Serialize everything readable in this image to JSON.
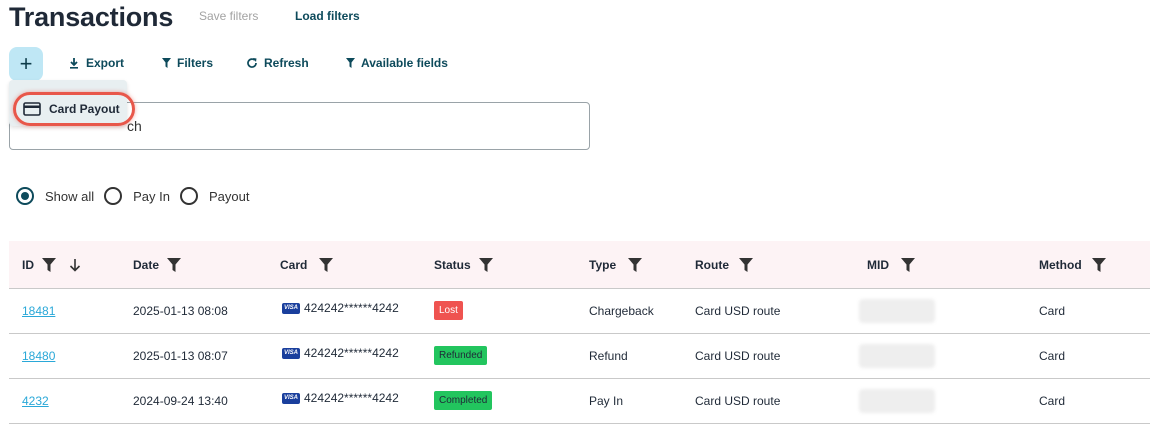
{
  "header": {
    "title": "Transactions",
    "save_filters": "Save filters",
    "load_filters": "Load filters"
  },
  "toolbar": {
    "add": "+",
    "export": "Export",
    "filters": "Filters",
    "refresh": "Refresh",
    "available_fields": "Available fields"
  },
  "dropdown": {
    "item": "Card Payout"
  },
  "search": {
    "visible_text": "ch"
  },
  "radios": {
    "show_all": "Show all",
    "pay_in": "Pay In",
    "payout": "Payout",
    "selected": "show_all"
  },
  "table": {
    "headers": {
      "id": "ID",
      "date": "Date",
      "card": "Card",
      "status": "Status",
      "type": "Type",
      "route": "Route",
      "mid": "MID",
      "method": "Method"
    },
    "rows": [
      {
        "id": "18481",
        "date": "2025-01-13 08:08",
        "card": "424242******4242",
        "status": "Lost",
        "type": "Chargeback",
        "route": "Card USD route",
        "method": "Card"
      },
      {
        "id": "18480",
        "date": "2025-01-13 08:07",
        "card": "424242******4242",
        "status": "Refunded",
        "type": "Refund",
        "route": "Card USD route",
        "method": "Card"
      },
      {
        "id": "4232",
        "date": "2024-09-24 13:40",
        "card": "424242******4242",
        "status": "Completed",
        "type": "Pay In",
        "route": "Card USD route",
        "method": "Card"
      }
    ],
    "card_brand": "VISA"
  },
  "colors": {
    "accent": "#0d4a5b",
    "add_button_bg": "#bfe7f5",
    "link": "#2aa8d8",
    "status_lost": "#ef5350",
    "status_success": "#22c55e",
    "highlight_ring": "#e8574a"
  }
}
